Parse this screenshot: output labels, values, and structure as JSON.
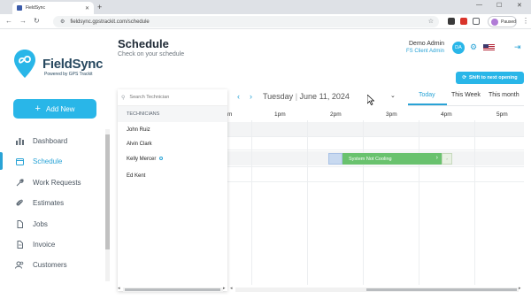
{
  "browser": {
    "tab_title": "FieldSync",
    "url": "fieldsync.gpstrackit.com/schedule",
    "profile_status": "Paused"
  },
  "brand": {
    "name": "FieldSync",
    "tagline": "Powered by GPS Trackit"
  },
  "add_new_label": "Add New",
  "nav": [
    {
      "label": "Dashboard",
      "icon": "bar-chart-icon",
      "active": false
    },
    {
      "label": "Schedule",
      "icon": "calendar-icon",
      "active": true
    },
    {
      "label": "Work Requests",
      "icon": "wrench-icon",
      "active": false
    },
    {
      "label": "Estimates",
      "icon": "paperclip-icon",
      "active": false
    },
    {
      "label": "Jobs",
      "icon": "briefcase-icon",
      "active": false
    },
    {
      "label": "Invoice",
      "icon": "document-icon",
      "active": false
    },
    {
      "label": "Customers",
      "icon": "users-icon",
      "active": false
    }
  ],
  "header": {
    "title": "Schedule",
    "subtitle": "Check on your schedule",
    "user_name": "Demo Admin",
    "user_role": "FS Client Admin",
    "avatar_initials": "DA",
    "shift_button": "Shift to next opening"
  },
  "technicians": {
    "search_placeholder": "Search Technician",
    "header": "TECHNICIANS",
    "list": [
      "John Ruiz",
      "Alvin Clark",
      "Kelly Mercer",
      "Ed Kent"
    ]
  },
  "calendar": {
    "day": "Tuesday",
    "date": "June 11, 2024",
    "views": [
      "Today",
      "This Week",
      "This month"
    ],
    "active_view": "Today",
    "hours": [
      "m",
      "1pm",
      "2pm",
      "3pm",
      "4pm",
      "5pm"
    ],
    "event": {
      "title": "System Not Cooling",
      "technician": "Kelly Mercer"
    }
  },
  "colors": {
    "accent": "#29b6e8",
    "brand_dark": "#27485f",
    "event": "#69c26e"
  }
}
